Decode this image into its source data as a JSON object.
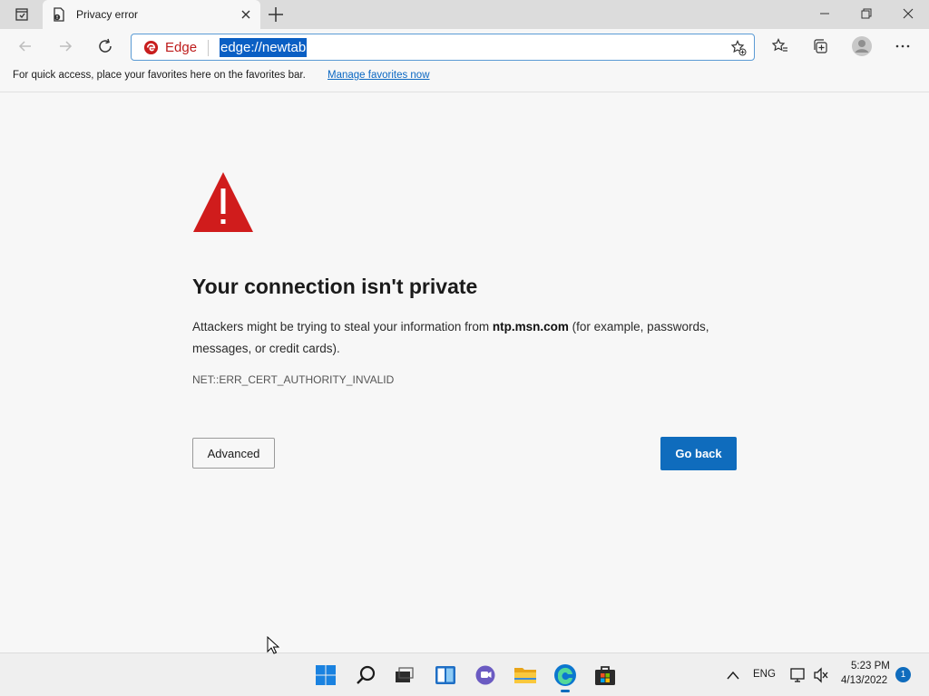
{
  "browser": {
    "tab_title": "Privacy error",
    "address_label": "Edge",
    "url": "edge://newtab"
  },
  "favorites_bar": {
    "message": "For quick access, place your favorites here on the favorites bar.",
    "link": "Manage favorites now"
  },
  "error_page": {
    "heading": "Your connection isn't private",
    "desc_prefix": "Attackers might be trying to steal your information from ",
    "host": "ntp.msn.com",
    "desc_suffix": " (for example, passwords, messages, or credit cards).",
    "error_code": "NET::ERR_CERT_AUTHORITY_INVALID",
    "advanced_label": "Advanced",
    "go_back_label": "Go back"
  },
  "taskbar": {
    "language": "ENG",
    "time": "5:23 PM",
    "date": "4/13/2022",
    "notification_count": "1"
  },
  "colors": {
    "accent": "#0f6cbd",
    "warning_red": "#d01c1c",
    "edge_red": "#bd1b1b"
  }
}
